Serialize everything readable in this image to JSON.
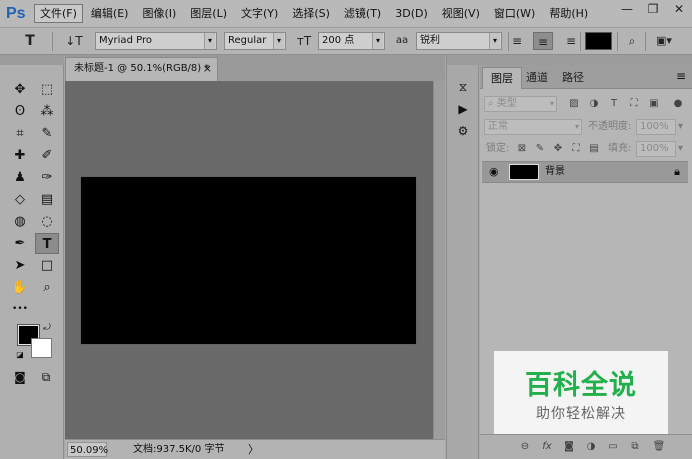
{
  "app": {
    "logo": "Ps"
  },
  "menu": {
    "items": [
      "文件(F)",
      "编辑(E)",
      "图像(I)",
      "图层(L)",
      "文字(Y)",
      "选择(S)",
      "滤镜(T)",
      "3D(D)",
      "视图(V)",
      "窗口(W)",
      "帮助(H)"
    ],
    "active_index": 0
  },
  "window_controls": {
    "minimize": "—",
    "restore": "❐",
    "close": "✕"
  },
  "options_bar": {
    "tool_icon": "T",
    "orientation_icon": "↓T",
    "font_family": "Myriad Pro",
    "font_style": "Regular",
    "size_icon": "тT",
    "font_size": "200 点",
    "aa_icon": "aa",
    "antialias": "锐利",
    "align_left_icon": "≡",
    "align_center_icon": "≡",
    "align_right_icon": "≡",
    "text_color": "#000000",
    "warp_icon": "⌕",
    "panel_toggle_icon": "▣▾"
  },
  "tools": [
    {
      "name": "move-tool",
      "glyph": "✥"
    },
    {
      "name": "marquee-tool",
      "glyph": "⬚"
    },
    {
      "name": "lasso-tool",
      "glyph": "ʘ"
    },
    {
      "name": "magic-wand-tool",
      "glyph": "⁂"
    },
    {
      "name": "crop-tool",
      "glyph": "⌗"
    },
    {
      "name": "eyedropper-tool",
      "glyph": "✎"
    },
    {
      "name": "healing-brush-tool",
      "glyph": "✚"
    },
    {
      "name": "brush-tool",
      "glyph": "✐"
    },
    {
      "name": "clone-stamp-tool",
      "glyph": "♟"
    },
    {
      "name": "history-brush-tool",
      "glyph": "✑"
    },
    {
      "name": "eraser-tool",
      "glyph": "◇"
    },
    {
      "name": "gradient-tool",
      "glyph": "▤"
    },
    {
      "name": "blur-tool",
      "glyph": "◍"
    },
    {
      "name": "dodge-tool",
      "glyph": "◌"
    },
    {
      "name": "pen-tool",
      "glyph": "✒"
    },
    {
      "name": "type-tool",
      "glyph": "T"
    },
    {
      "name": "path-selection-tool",
      "glyph": "➤"
    },
    {
      "name": "rectangle-tool",
      "glyph": "□"
    },
    {
      "name": "hand-tool",
      "glyph": "✋"
    },
    {
      "name": "zoom-tool",
      "glyph": "⌕"
    },
    {
      "name": "edit-toolbar",
      "glyph": "•••"
    }
  ],
  "colors": {
    "foreground": "#000000",
    "background": "#ffffff",
    "canvas": "#000000",
    "pasteboard": "#696969"
  },
  "document": {
    "tab_title": "未标题-1 @ 50.1%(RGB/8) *",
    "close": "×"
  },
  "status": {
    "zoom": "50.09%",
    "doc_info": "文档:937.5K/0 字节",
    "arrow": "〉"
  },
  "mini_panel": {
    "history_icon": "⧖",
    "play_icon": "▶",
    "properties_icon": "⚙"
  },
  "layers_panel": {
    "tabs": [
      "图层",
      "通道",
      "路径"
    ],
    "menu_icon": "≡",
    "filter_kind": "类型",
    "blend_mode": "正常",
    "opacity_label": "不透明度:",
    "opacity_value": "100%",
    "lock_label": "锁定:",
    "fill_label": "填充:",
    "fill_value": "100%",
    "layers": [
      {
        "name": "背景",
        "visible": true,
        "locked": true
      }
    ]
  },
  "watermark": {
    "title": "百科全说",
    "subtitle": "助你轻松解决"
  }
}
